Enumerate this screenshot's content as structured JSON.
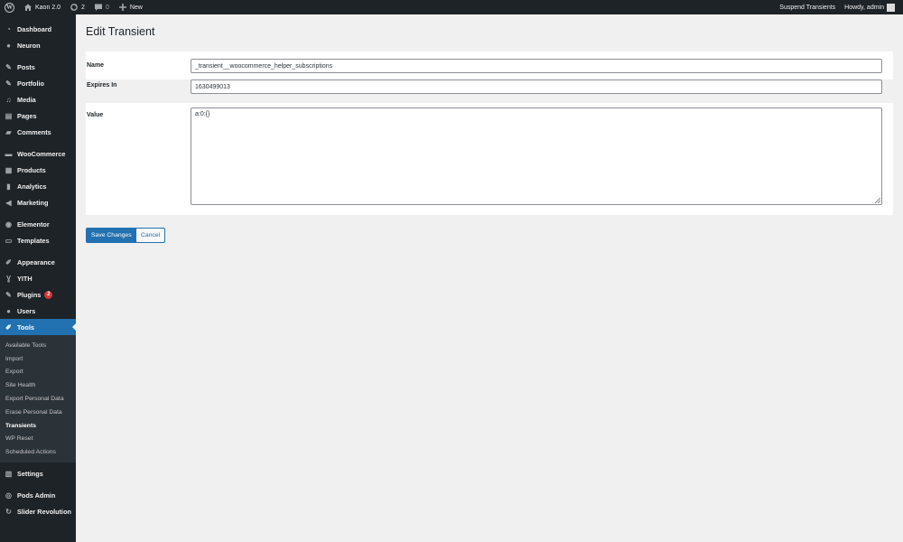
{
  "adminbar": {
    "site_name": "Kaon 2.0",
    "updates_count": "2",
    "comments_count": "0",
    "new_label": "New",
    "suspend_label": "Suspend Transients",
    "howdy_label": "Howdy, admin"
  },
  "sidebar": {
    "items": [
      {
        "label": "Dashboard",
        "icon": "dashboard-icon"
      },
      {
        "label": "Neuron",
        "icon": "neuron-icon"
      },
      {
        "label": "Posts",
        "icon": "pin-icon"
      },
      {
        "label": "Portfolio",
        "icon": "portfolio-icon"
      },
      {
        "label": "Media",
        "icon": "media-icon"
      },
      {
        "label": "Pages",
        "icon": "pages-icon"
      },
      {
        "label": "Comments",
        "icon": "comment-icon"
      },
      {
        "label": "WooCommerce",
        "icon": "woocommerce-icon"
      },
      {
        "label": "Products",
        "icon": "products-icon"
      },
      {
        "label": "Analytics",
        "icon": "analytics-icon"
      },
      {
        "label": "Marketing",
        "icon": "megaphone-icon"
      },
      {
        "label": "Elementor",
        "icon": "elementor-icon"
      },
      {
        "label": "Templates",
        "icon": "folder-icon"
      },
      {
        "label": "Appearance",
        "icon": "brush-icon"
      },
      {
        "label": "YITH",
        "icon": "yith-icon"
      },
      {
        "label": "Plugins",
        "icon": "plugin-icon",
        "badge": "2"
      },
      {
        "label": "Users",
        "icon": "users-icon"
      },
      {
        "label": "Tools",
        "icon": "wrench-icon"
      },
      {
        "label": "Settings",
        "icon": "settings-icon"
      },
      {
        "label": "Pods Admin",
        "icon": "pods-icon"
      },
      {
        "label": "Slider Revolution",
        "icon": "slider-icon"
      }
    ],
    "tools_submenu": [
      "Available Tools",
      "Import",
      "Export",
      "Site Health",
      "Export Personal Data",
      "Erase Personal Data",
      "Transients",
      "WP Reset",
      "Scheduled Actions"
    ]
  },
  "main": {
    "title": "Edit Transient",
    "fields": {
      "name_label": "Name",
      "name_value": "_transient__woocommerce_helper_subscriptions",
      "expires_label": "Expires In",
      "expires_value": "1630499013",
      "value_label": "Value",
      "value_value": "a:0:{}"
    },
    "save_label": "Save Changes",
    "cancel_label": "Cancel"
  },
  "colors": {
    "accent": "#2271b1",
    "sidebar_bg": "#1d2327",
    "badge": "#d63638"
  }
}
